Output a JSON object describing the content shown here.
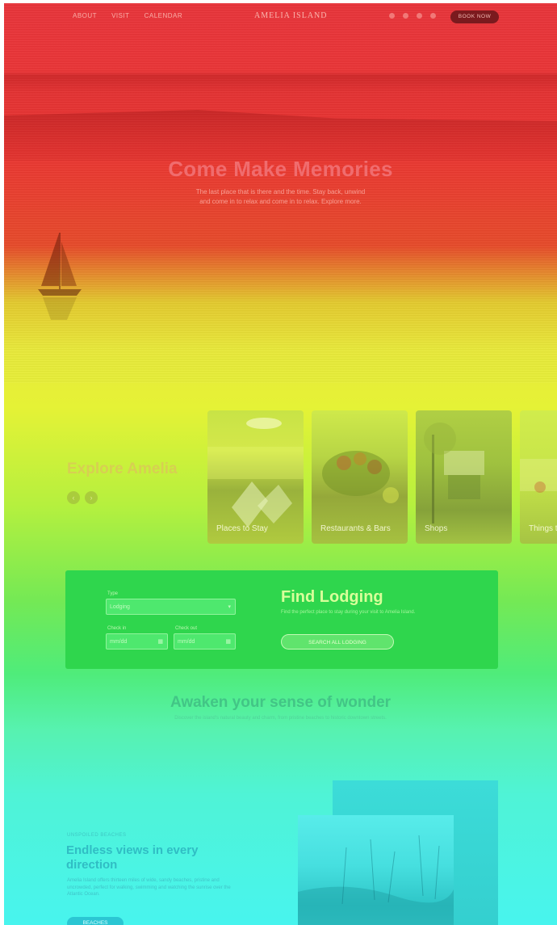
{
  "nav": {
    "links": [
      "ABOUT",
      "VISIT",
      "CALENDAR"
    ],
    "logo": "AMELIA ISLAND",
    "book_label": "BOOK NOW"
  },
  "hero": {
    "title": "Come Make Memories",
    "subtitle": "The last place that is there and the time. Stay back, unwind and come in to relax and come in to relax. Explore more."
  },
  "explore": {
    "title": "Explore Amelia",
    "cards": [
      {
        "label": "Places to Stay"
      },
      {
        "label": "Restaurants & Bars"
      },
      {
        "label": "Shops"
      },
      {
        "label": "Things to Do"
      }
    ]
  },
  "lodging": {
    "title": "Find Lodging",
    "type_label": "Type",
    "type_value": "Lodging",
    "checkin_label": "Check in",
    "checkout_label": "Check out",
    "checkin_value": "mm/dd",
    "checkout_value": "mm/dd",
    "text": "Find the perfect place to stay during your visit to Amelia Island.",
    "button": "SEARCH ALL LODGING"
  },
  "wonder": {
    "title": "Awaken your sense of wonder",
    "subtitle": "Discover the island's natural beauty and charm, from pristine beaches to historic downtown streets."
  },
  "endless": {
    "kicker": "UNSPOILED BEACHES",
    "title": "Endless views in every direction",
    "text": "Amelia Island offers thirteen miles of wide, sandy beaches, pristine and uncrowded, perfect for walking, swimming and watching the sunrise over the Atlantic Ocean.",
    "button": "BEACHES"
  },
  "colors": {
    "accent_red": "#e8343a",
    "accent_green": "#2fd64d",
    "accent_cyan": "#2bc6d3"
  }
}
